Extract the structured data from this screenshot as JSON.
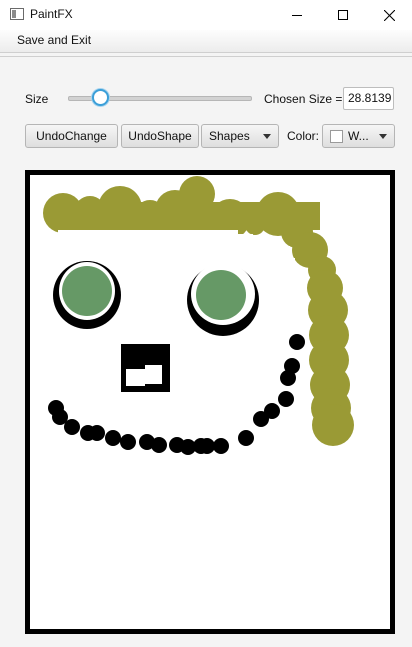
{
  "window": {
    "title": "PaintFX"
  },
  "menu": {
    "save_exit": "Save and Exit"
  },
  "controls": {
    "size_label": "Size",
    "slider_value_fraction": 0.18,
    "chosen_size_label": "Chosen Size =",
    "chosen_size_value": "28.8139",
    "undo_change": "UndoChange",
    "undo_shape": "UndoShape",
    "shapes_value": "Shapes",
    "color_label": "Color:",
    "color_value": "W...",
    "color_swatch": "#ffffff"
  },
  "icons": {
    "app": "paint-app-icon",
    "minimize": "minimize-icon",
    "maximize": "maximize-icon",
    "close": "close-icon",
    "dropdown": "chevron-down-icon"
  },
  "colors": {
    "olive": "#9a9a35",
    "green": "#669966",
    "black": "#000000",
    "white": "#ffffff",
    "accent": "#3b9fd8"
  }
}
